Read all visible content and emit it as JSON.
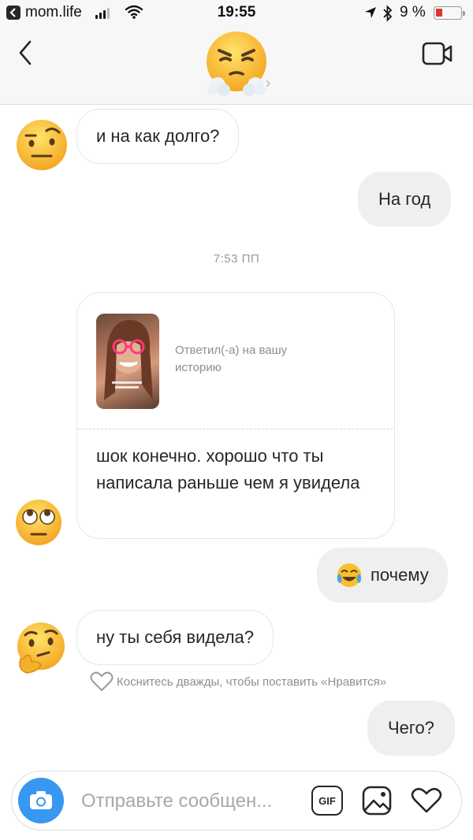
{
  "status_bar": {
    "back_app": "mom.life",
    "time": "19:55",
    "battery_percent": "9 %",
    "battery_level": 0.09,
    "battery_color": "#e0322f"
  },
  "header": {
    "avatar_icon": "steam-from-nose-emoji-icon",
    "back_icon": "chevron-left-icon",
    "video_icon": "video-camera-icon"
  },
  "messages": [
    {
      "side": "in",
      "text": "и на как долго?",
      "avatar": "raised-eyebrow-emoji-icon"
    },
    {
      "side": "out",
      "text": "На год"
    },
    {
      "side": "in",
      "type": "story_reply",
      "caption": "Ответил(-а) на вашу историю",
      "text": "шок конечно. хорошо что ты написала раньше чем я увидела",
      "avatar": "rolling-eyes-emoji-icon"
    },
    {
      "side": "out",
      "text": "почему",
      "emoji": "tears-of-joy-emoji-icon"
    },
    {
      "side": "in",
      "text": "ну ты себя видела?",
      "avatar": "thinking-emoji-icon"
    },
    {
      "side": "out",
      "text": "Чего?"
    }
  ],
  "timestamp": "7:53 ПП",
  "like_hint": "Коснитесь дважды, чтобы поставить «Нравится»",
  "composer": {
    "placeholder": "Отправьте сообщен...",
    "gif_label": "GIF"
  },
  "colors": {
    "accent": "#3897f0",
    "bubble_out": "#efefef",
    "border": "#dbdbdb"
  }
}
